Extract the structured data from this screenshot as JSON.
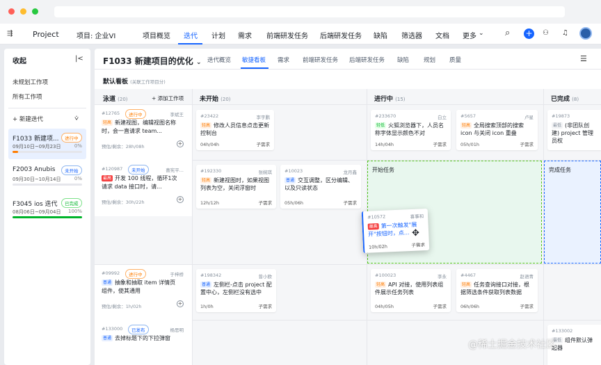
{
  "nav": {
    "project_label": "Project",
    "project_select": "项目: 企业VI",
    "tabs": [
      "项目概览",
      "迭代",
      "计划",
      "需求",
      "前端研发任务",
      "后端研发任务",
      "缺陷",
      "筛选器",
      "文档",
      "更多"
    ],
    "more_suffix": "⌄"
  },
  "sidebar": {
    "title": "收起",
    "items": [
      "未规划工作项",
      "所有工作项"
    ],
    "new_iter": "新建迭代",
    "iterations": [
      {
        "name": "F1033 新建项...",
        "status": "进行中",
        "dates": "09月10日~09月23日",
        "pct": "0%",
        "progress": 0.08,
        "color": "#ff7d00"
      },
      {
        "name": "F2003 Anubis",
        "status": "未开始",
        "dates": "09月30日~10月14日",
        "pct": "0%",
        "progress": 0,
        "color": "#1664ff"
      },
      {
        "name": "F3045 ios 迭代",
        "status": "已完成",
        "dates": "08月06日~09月04日",
        "pct": "100%",
        "progress": 1,
        "color": "#00b42a"
      }
    ]
  },
  "header": {
    "title": "F1033 新建项目的优化",
    "subtabs": [
      "迭代概览",
      "敏捷看板",
      "需求",
      "前端研发任务",
      "后端研发任务",
      "缺陷",
      "规划",
      "质量"
    ]
  },
  "board": {
    "title": "默认看板",
    "note": "(关联工作项目分)",
    "plan_col": {
      "label": "泳道",
      "count": "(20)",
      "add": "添加工作项"
    },
    "columns": [
      {
        "label": "未开始",
        "count": "(20)"
      },
      {
        "label": "进行中",
        "count": "(15)"
      },
      {
        "label": "已完成",
        "count": "(8)"
      }
    ],
    "zones": [
      "开始任务",
      "完成任务"
    ],
    "plans": [
      {
        "id": "#12765",
        "status": "进行中",
        "owner": "李斌王",
        "tag": "轻高",
        "title": "新建视图，编辑视图名称时，会一直请求 team...",
        "time": "预估/剩余：28h/08h"
      },
      {
        "id": "#120987",
        "status": "未开始",
        "owner": "喜宪平...",
        "tag": "最高",
        "title": "开发 100 线程，循环1次请求 data 接口时，请...",
        "time": "预估/剩余：30h/22h"
      },
      {
        "id": "#09992",
        "status": "进行中",
        "owner": "于梓桥",
        "tag": "普通",
        "title": "抽象和抽取 item 详情页组件，使其通用",
        "time": "预估/剩余：1h/02h"
      },
      {
        "id": "#133000",
        "status": "已发布",
        "owner": "杨思明",
        "tag": "普通",
        "title": "去掉标题下的下拉弹窗",
        "time": ""
      }
    ],
    "cards": [
      {
        "id": "#23422",
        "owner": "李宇鹏",
        "tag": "轻高",
        "title": "修改人员信息点击更新控制台",
        "time": "04h/04h",
        "type": "子需求"
      },
      {
        "id": "#233670",
        "owner": "白立",
        "tag": "轻低",
        "title": "火狐浏览器下，人员名称字体显示颜色不对",
        "time": "14h/04h",
        "type": "子需求"
      },
      {
        "id": "#5657",
        "owner": "卢星",
        "tag": "轻高",
        "title": "全局搜索顶部的搜索 icon 与关闭 icon 重叠",
        "time": "05h/01h",
        "type": "子需求"
      },
      {
        "id": "#19873",
        "owner": "",
        "tag": "最低",
        "title": "(非团队创建) project 管理员权",
        "time": "",
        "type": ""
      },
      {
        "id": "#192330",
        "owner": "张婉琪",
        "tag": "轻高",
        "title": "新建视图时，如果视图列表为空，关闭浮窗时",
        "time": "12h/12h",
        "type": "子需求"
      },
      {
        "id": "#10023",
        "owner": "龙月鑫",
        "tag": "普通",
        "title": "交互调整，区分编辑、以及只读状态",
        "time": "05h/06h",
        "type": "子需求"
      },
      {
        "id": "#10572",
        "owner": "喜事和",
        "tag": "最高",
        "title": "第一次触发\"展开\"按钮时，点...",
        "time": "10h/02h",
        "type": "子需求"
      },
      {
        "id": "#198342",
        "owner": "曾小欧",
        "tag": "普通",
        "title": "左侧栏-点击 project 配置中心，左侧栏没有选中",
        "time": "1h/0h",
        "type": "子需求"
      },
      {
        "id": "#100023",
        "owner": "李永",
        "tag": "轻高",
        "title": "API 对接，使用列表组件展示任务列表",
        "time": "04h/05h",
        "type": "子需求"
      },
      {
        "id": "#4467",
        "owner": "赵语青",
        "tag": "轻高",
        "title": "任务查询接口对接，根据筛选条件获取列表数据",
        "time": "06h/06h",
        "type": "子需求"
      },
      {
        "id": "#133002",
        "owner": "",
        "tag": "最低",
        "title": "组件默认弹起器",
        "time": "",
        "type": ""
      }
    ]
  },
  "watermark": "@稀土掘金技术社区",
  "colors": {
    "accent": "#1664ff",
    "zone_green": "#e8f7ee",
    "zone_blue": "#eaf2ff"
  }
}
